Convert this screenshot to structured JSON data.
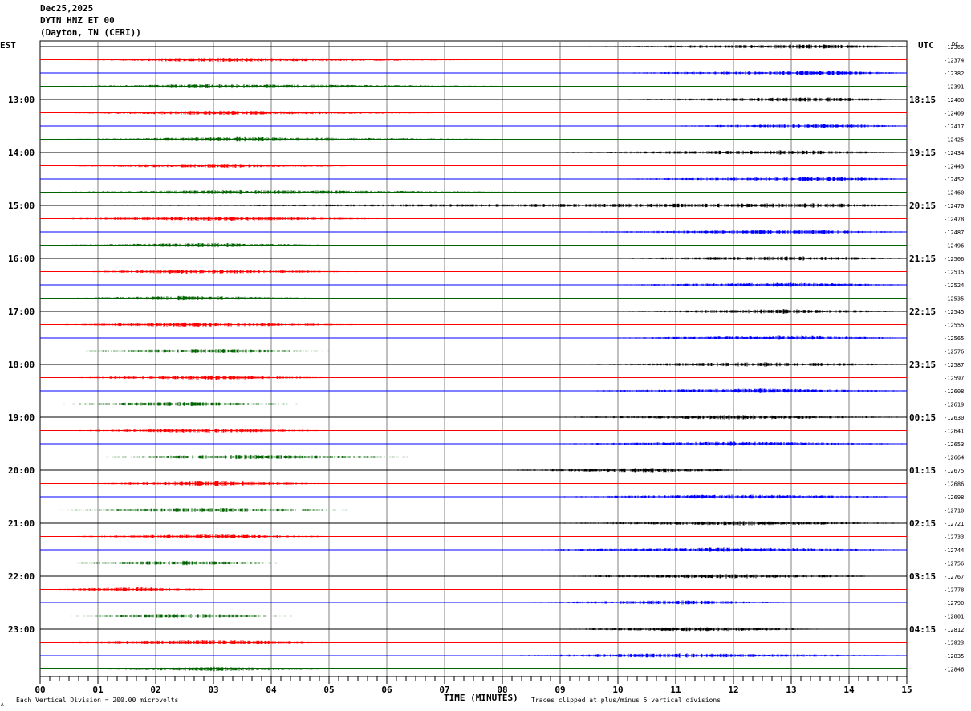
{
  "header": {
    "date": "Dec25,2025",
    "station": "DYTN HNZ ET 00",
    "location": "(Dayton, TN (CERI))"
  },
  "footer": {
    "scale_note": "Each Vertical Division =  200.00 microvolts",
    "clip_note": "Traces clipped at plus/minus 5 vertical divisions",
    "corner_mark": "A"
  },
  "colors": {
    "black": "#000000",
    "red": "#ff0000",
    "blue": "#0000ff",
    "green": "#006400",
    "grid": "#808080"
  },
  "chart_data": {
    "type": "line",
    "title": "",
    "xlabel": "TIME (MINUTES)",
    "x_ticks": [
      "00",
      "01",
      "02",
      "03",
      "04",
      "05",
      "06",
      "07",
      "08",
      "09",
      "10",
      "11",
      "12",
      "13",
      "14",
      "15"
    ],
    "xlim": [
      0,
      15
    ],
    "left_axis_label": "EST",
    "right_axis_label": "UTC",
    "dc_label": "DC",
    "trace_color_cycle": [
      "black",
      "red",
      "blue",
      "green"
    ],
    "hour_labels_est": [
      "13:00",
      "14:00",
      "15:00",
      "16:00",
      "17:00",
      "18:00",
      "19:00",
      "20:00",
      "21:00",
      "22:00",
      "23:00"
    ],
    "hour_labels_utc": [
      "18:15",
      "19:15",
      "20:15",
      "21:15",
      "22:15",
      "23:15",
      "00:15",
      "01:15",
      "02:15",
      "03:15",
      "04:15"
    ],
    "dc_offsets": [
      "-12366",
      "-12374",
      "-12382",
      "-12391",
      "-12400",
      "-12409",
      "-12417",
      "-12425",
      "-12434",
      "-12443",
      "-12452",
      "-12460",
      "-12470",
      "-12478",
      "-12487",
      "-12496",
      "-12506",
      "-12515",
      "-12524",
      "-12535",
      "-12545",
      "-12555",
      "-12565",
      "-12576",
      "-12587",
      "-12597",
      "-12608",
      "-12619",
      "-12630",
      "-12641",
      "-12653",
      "-12664",
      "-12675",
      "-12686",
      "-12698",
      "-12710",
      "-12721",
      "-12733",
      "-12744",
      "-12756",
      "-12767",
      "-12778",
      "-12790",
      "-12801",
      "-12812",
      "-12823",
      "-12835",
      "-12846"
    ],
    "noise_bursts": [
      {
        "trace": 0,
        "start_min": 9.5,
        "end_min": 15,
        "peak_min": 13.5
      },
      {
        "trace": 1,
        "start_min": 0.5,
        "end_min": 7.5,
        "peak_min": 3.0
      },
      {
        "trace": 2,
        "start_min": 10.0,
        "end_min": 15,
        "peak_min": 13.5
      },
      {
        "trace": 3,
        "start_min": 0.5,
        "end_min": 8.0,
        "peak_min": 3.0
      },
      {
        "trace": 4,
        "start_min": 10.0,
        "end_min": 15,
        "peak_min": 13.5
      },
      {
        "trace": 5,
        "start_min": 0.3,
        "end_min": 7.0,
        "peak_min": 3.0
      },
      {
        "trace": 6,
        "start_min": 11.0,
        "end_min": 15,
        "peak_min": 13.5
      },
      {
        "trace": 7,
        "start_min": 0.3,
        "end_min": 8.0,
        "peak_min": 3.5
      },
      {
        "trace": 8,
        "start_min": 9.0,
        "end_min": 15,
        "peak_min": 13.0
      },
      {
        "trace": 9,
        "start_min": 0.3,
        "end_min": 5.5,
        "peak_min": 3.0
      },
      {
        "trace": 10,
        "start_min": 10.0,
        "end_min": 15,
        "peak_min": 13.5
      },
      {
        "trace": 11,
        "start_min": 0.3,
        "end_min": 8.5,
        "peak_min": 3.5
      },
      {
        "trace": 12,
        "start_min": 1.0,
        "end_min": 15,
        "peak_min": 13.5
      },
      {
        "trace": 13,
        "start_min": 0.3,
        "end_min": 6.0,
        "peak_min": 3.0
      },
      {
        "trace": 14,
        "start_min": 9.5,
        "end_min": 15,
        "peak_min": 13.0
      },
      {
        "trace": 15,
        "start_min": 0.3,
        "end_min": 5.0,
        "peak_min": 3.0
      },
      {
        "trace": 16,
        "start_min": 10.0,
        "end_min": 15,
        "peak_min": 13.0
      },
      {
        "trace": 17,
        "start_min": 0.8,
        "end_min": 5.5,
        "peak_min": 2.5
      },
      {
        "trace": 18,
        "start_min": 10.0,
        "end_min": 15,
        "peak_min": 13.0
      },
      {
        "trace": 19,
        "start_min": 0.5,
        "end_min": 5.0,
        "peak_min": 2.5
      },
      {
        "trace": 20,
        "start_min": 10.0,
        "end_min": 15,
        "peak_min": 13.0
      },
      {
        "trace": 21,
        "start_min": 0.3,
        "end_min": 5.5,
        "peak_min": 2.5
      },
      {
        "trace": 22,
        "start_min": 10.0,
        "end_min": 15,
        "peak_min": 13.0
      },
      {
        "trace": 23,
        "start_min": 0.5,
        "end_min": 5.0,
        "peak_min": 3.0
      },
      {
        "trace": 24,
        "start_min": 9.5,
        "end_min": 15,
        "peak_min": 12.5
      },
      {
        "trace": 25,
        "start_min": 0.5,
        "end_min": 5.0,
        "peak_min": 3.0
      },
      {
        "trace": 26,
        "start_min": 9.5,
        "end_min": 15,
        "peak_min": 12.5
      },
      {
        "trace": 27,
        "start_min": 0.3,
        "end_min": 4.5,
        "peak_min": 2.5
      },
      {
        "trace": 28,
        "start_min": 9.0,
        "end_min": 15,
        "peak_min": 12.0
      },
      {
        "trace": 29,
        "start_min": 0.5,
        "end_min": 5.0,
        "peak_min": 3.0
      },
      {
        "trace": 30,
        "start_min": 9.0,
        "end_min": 15,
        "peak_min": 12.0
      },
      {
        "trace": 31,
        "start_min": 1.0,
        "end_min": 6.5,
        "peak_min": 3.5
      },
      {
        "trace": 32,
        "start_min": 8.0,
        "end_min": 12.2,
        "peak_min": 10.5
      },
      {
        "trace": 33,
        "start_min": 0.8,
        "end_min": 5.0,
        "peak_min": 3.0
      },
      {
        "trace": 34,
        "start_min": 9.0,
        "end_min": 15,
        "peak_min": 12.0
      },
      {
        "trace": 35,
        "start_min": 0.3,
        "end_min": 5.5,
        "peak_min": 3.0
      },
      {
        "trace": 36,
        "start_min": 9.0,
        "end_min": 15,
        "peak_min": 12.0
      },
      {
        "trace": 37,
        "start_min": 0.5,
        "end_min": 5.0,
        "peak_min": 3.0
      },
      {
        "trace": 38,
        "start_min": 8.5,
        "end_min": 15,
        "peak_min": 12.0
      },
      {
        "trace": 39,
        "start_min": 0.5,
        "end_min": 4.2,
        "peak_min": 2.5
      },
      {
        "trace": 40,
        "start_min": 9.0,
        "end_min": 14.5,
        "peak_min": 12.0
      },
      {
        "trace": 41,
        "start_min": 0.3,
        "end_min": 3.0,
        "peak_min": 1.5
      },
      {
        "trace": 42,
        "start_min": 8.5,
        "end_min": 13.0,
        "peak_min": 11.0
      },
      {
        "trace": 43,
        "start_min": 0.5,
        "end_min": 4.5,
        "peak_min": 2.5
      },
      {
        "trace": 44,
        "start_min": 9.0,
        "end_min": 13.5,
        "peak_min": 11.5
      },
      {
        "trace": 45,
        "start_min": 0.5,
        "end_min": 5.0,
        "peak_min": 3.0
      },
      {
        "trace": 46,
        "start_min": 8.0,
        "end_min": 15,
        "peak_min": 11.0
      },
      {
        "trace": 47,
        "start_min": 1.0,
        "end_min": 5.0,
        "peak_min": 3.0
      }
    ]
  }
}
